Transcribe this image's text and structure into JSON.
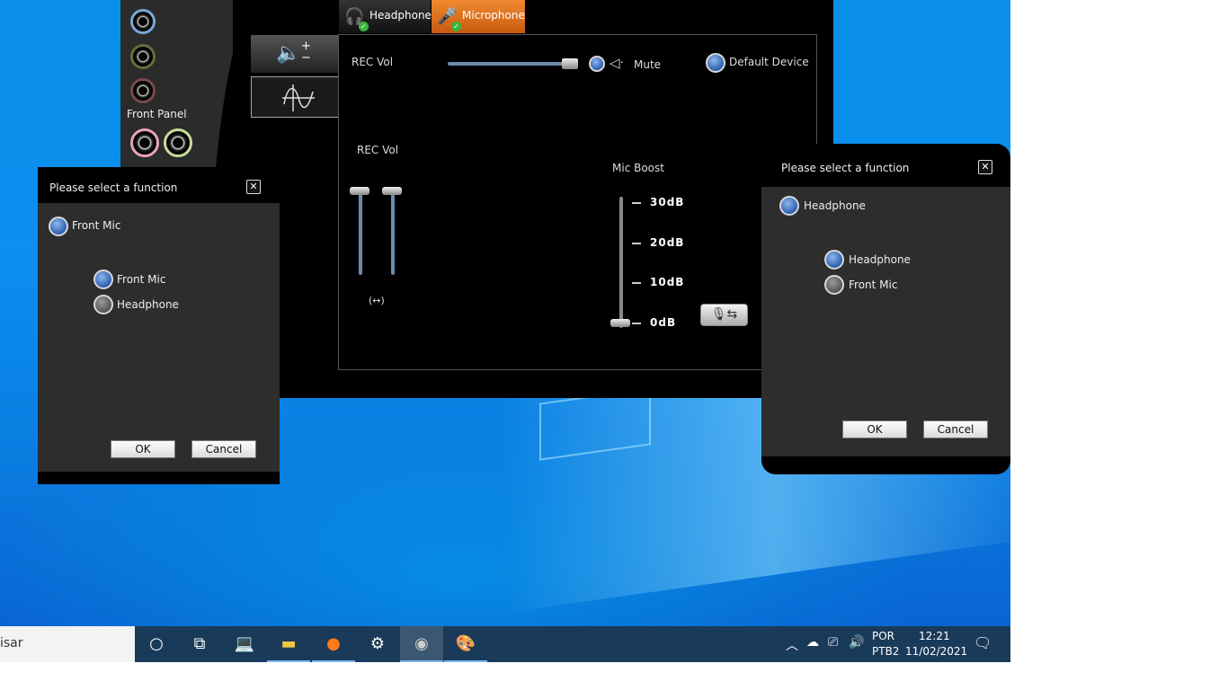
{
  "main_window": {
    "front_panel_label": "Front Panel",
    "tabs": [
      {
        "label": "Headphone",
        "icon": "headphone-icon"
      },
      {
        "label": "Microphone",
        "icon": "microphone-icon"
      }
    ],
    "rec_vol_label_top": "REC Vol",
    "mute_label": "Mute",
    "default_device_label": "Default Device",
    "rec_vol_label": "REC Vol",
    "link_symbol": "(↔)",
    "mic_boost_label": "Mic Boost",
    "boost_levels": [
      "30dB",
      "20dB",
      "10dB",
      "0dB"
    ],
    "boost_value_db": 0,
    "rec_vol_level": 1.0
  },
  "dialog_left": {
    "title": "Please select a function",
    "selected_label": "Front Mic",
    "options": [
      {
        "label": "Front Mic",
        "selected": true
      },
      {
        "label": "Headphone",
        "selected": false
      }
    ],
    "ok_label": "OK",
    "cancel_label": "Cancel"
  },
  "dialog_right": {
    "title": "Please select a function",
    "selected_label": "Headphone",
    "options": [
      {
        "label": "Headphone",
        "selected": true
      },
      {
        "label": "Front Mic",
        "selected": false
      }
    ],
    "ok_label": "OK",
    "cancel_label": "Cancel"
  },
  "taskbar": {
    "search_text": "isar",
    "language": "POR",
    "layout": "PTB2",
    "time": "12:21",
    "date": "11/02/2021"
  },
  "colors": {
    "microphone_tab": "#e07020",
    "radio_selected": "#3a6fc4",
    "slider_track": "#6c8cae"
  }
}
